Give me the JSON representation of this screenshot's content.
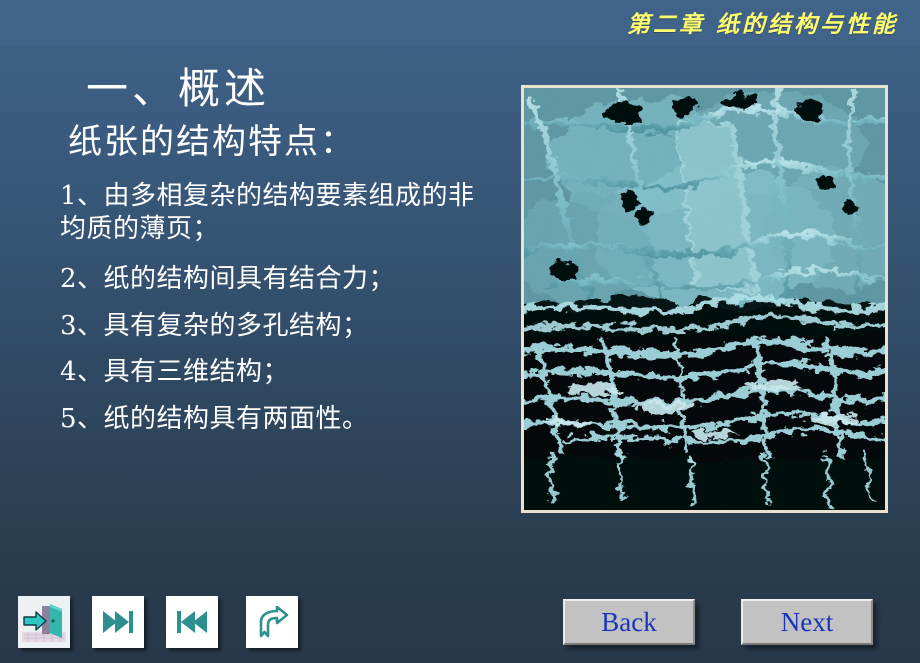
{
  "header": {
    "chapter_title": "第二章  纸的结构与性能"
  },
  "content": {
    "section_title": "一、概述",
    "subtitle": "纸张的结构特点：",
    "points": [
      "1、由多相复杂的结构要素组成的非均质的薄页；",
      "2、纸的结构间具有结合力；",
      "3、具有复杂的多孔结构；",
      "4、具有三维结构；",
      "5、纸的结构具有两面性。"
    ]
  },
  "figure": {
    "alt": "纸张纤维结构扫描电镜照片",
    "icon": "sem-micrograph"
  },
  "nav": {
    "exit": {
      "icon": "exit-door-icon",
      "label": ""
    },
    "last_slide": {
      "icon": "skip-to-end-icon",
      "label": ""
    },
    "first_slide": {
      "icon": "skip-to-start-icon",
      "label": ""
    },
    "return": {
      "icon": "curved-return-arrow-icon",
      "label": ""
    },
    "back_label": "Back",
    "next_label": "Next"
  },
  "colors": {
    "header_bg": "#3f6389",
    "header_text": "#fffd6e",
    "body_text": "#ffffff",
    "button_text": "#1a36b8",
    "button_face": "#c2c2c2",
    "icon_teal": "#2e8f91",
    "fiber_cyan": "#8fd4dd"
  }
}
